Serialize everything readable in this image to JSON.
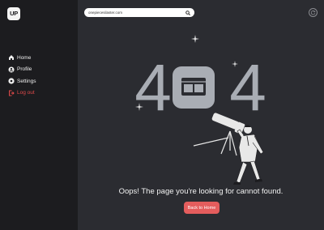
{
  "sidebar": {
    "logo": "UP",
    "items": [
      {
        "label": "Home",
        "icon": "home-icon"
      },
      {
        "label": "Profile",
        "icon": "user-icon"
      },
      {
        "label": "Settings",
        "icon": "gear-icon"
      },
      {
        "label": "Log out",
        "icon": "logout-icon"
      }
    ]
  },
  "search": {
    "value": "onepiecesilaster.com"
  },
  "error": {
    "code_left": "4",
    "code_right": "4",
    "message": "Oops! The page you're looking for cannot found.",
    "back_label": "Back to Home"
  },
  "colors": {
    "sidebar_bg": "#1c1c1f",
    "main_bg": "#2b2c31",
    "accent": "#e45d5d",
    "logout": "#e04a4a",
    "digits": "#a9adb4"
  }
}
